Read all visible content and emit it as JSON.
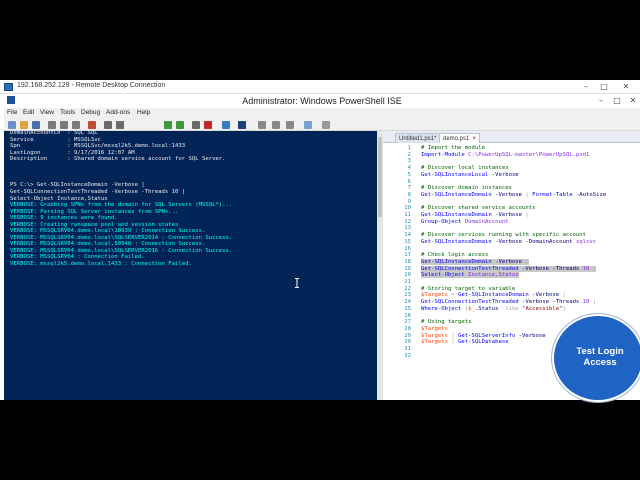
{
  "rdp": {
    "title": "192.168.252.129 - Remote Desktop Connection",
    "controls": [
      "–",
      "□",
      "✕"
    ]
  },
  "ise": {
    "title": "Administrator: Windows PowerShell ISE",
    "controls": [
      "–",
      "□",
      "✕"
    ],
    "menu": [
      "File",
      "Edit",
      "View",
      "Tools",
      "Debug",
      "Add-ons",
      "Help"
    ]
  },
  "console": {
    "lines": [
      {
        "text": "DomainAccountCn  : SQL SQL",
        "kind": "normal"
      },
      {
        "text": "Service          : MSSQLSvc",
        "kind": "normal"
      },
      {
        "text": "Spn              : MSSQLSvc/mssql2k5.demo.local:1433",
        "kind": "normal"
      },
      {
        "text": "LastLogon        : 9/17/2016 12:07 AM",
        "kind": "normal"
      },
      {
        "text": "Description      : Shared domain service account for SQL Server.",
        "kind": "normal"
      },
      {
        "text": "",
        "kind": "normal"
      },
      {
        "text": "",
        "kind": "normal"
      },
      {
        "text": "",
        "kind": "normal"
      },
      {
        "text": "PS C:\\> Get-SQLInstanceDomain -Verbose |",
        "kind": "normal"
      },
      {
        "text": "Get-SQLConnectionTestThreaded -Verbose -Threads 10 |",
        "kind": "normal"
      },
      {
        "text": "Select-Object Instance,Status",
        "kind": "normal"
      },
      {
        "text": "VERBOSE: Grabbing SPNs from the domain for SQL Servers (MSSQL*)...",
        "kind": "verbose"
      },
      {
        "text": "VERBOSE: Parsing SQL Server instances from SPNs...",
        "kind": "verbose"
      },
      {
        "text": "VERBOSE: 9 instances were found.",
        "kind": "verbose"
      },
      {
        "text": "VERBOSE: Creating runspace pool and session states",
        "kind": "verbose"
      },
      {
        "text": "VERBOSE: MSSQLSRV04.demo.local\\10939 : Connection Success.",
        "kind": "verbose"
      },
      {
        "text": "VERBOSE: MSSQLSRV04.demo.local\\SQLSERVER2014 : Connection Success.",
        "kind": "verbose"
      },
      {
        "text": "VERBOSE: MSSQLSRV04.demo.local,50948 : Connection Success.",
        "kind": "verbose"
      },
      {
        "text": "VERBOSE: MSSQLSRV04.demo.local\\SQLSERVER2016 : Connection Success.",
        "kind": "verbose"
      },
      {
        "text": "VERBOSE: MSSQLSRV04 : Connection Failed.",
        "kind": "verbose"
      },
      {
        "text": "VERBOSE: mssql2k5.demo.local,1433 : Connection Failed.",
        "kind": "verbose"
      }
    ]
  },
  "editor": {
    "tabs": [
      {
        "label": "Untitled1.ps1*",
        "active": false
      },
      {
        "label": "demo.ps1",
        "active": true
      }
    ],
    "lines": [
      {
        "num": "1",
        "parts": [
          {
            "t": "# Import the module",
            "c": "c-comment"
          }
        ]
      },
      {
        "num": "2",
        "parts": [
          {
            "t": "Import-Module ",
            "c": "c-cmd"
          },
          {
            "t": "C:\\PowerUpSQL-master\\PowerUpSQL.psd1",
            "c": "c-arg"
          }
        ]
      },
      {
        "num": "3",
        "parts": []
      },
      {
        "num": "4",
        "parts": [
          {
            "t": "# Discover local instances",
            "c": "c-comment"
          }
        ]
      },
      {
        "num": "5",
        "parts": [
          {
            "t": "Get-SQLInstanceLocal ",
            "c": "c-cmd"
          },
          {
            "t": "-Verbose",
            "c": "c-param"
          }
        ]
      },
      {
        "num": "6",
        "parts": []
      },
      {
        "num": "7",
        "parts": [
          {
            "t": "# Discover domain instances",
            "c": "c-comment"
          }
        ]
      },
      {
        "num": "8",
        "parts": [
          {
            "t": "Get-SQLInstanceDomain ",
            "c": "c-cmd"
          },
          {
            "t": "-Verbose ",
            "c": "c-param"
          },
          {
            "t": "| ",
            "c": "c-op"
          },
          {
            "t": "Format-Table ",
            "c": "c-cmd"
          },
          {
            "t": "-AutoSize",
            "c": "c-param"
          }
        ]
      },
      {
        "num": "9",
        "parts": []
      },
      {
        "num": "10",
        "parts": [
          {
            "t": "# Discover shared service accounts",
            "c": "c-comment"
          }
        ]
      },
      {
        "num": "11",
        "parts": [
          {
            "t": "Get-SQLInstanceDomain ",
            "c": "c-cmd"
          },
          {
            "t": "-Verbose ",
            "c": "c-param"
          },
          {
            "t": "|",
            "c": "c-op"
          }
        ]
      },
      {
        "num": "12",
        "parts": [
          {
            "t": "Group-Object ",
            "c": "c-cmd"
          },
          {
            "t": "DomainAccount",
            "c": "c-arg"
          }
        ]
      },
      {
        "num": "13",
        "parts": []
      },
      {
        "num": "14",
        "parts": [
          {
            "t": "# Discover services running with specific account",
            "c": "c-comment"
          }
        ]
      },
      {
        "num": "15",
        "parts": [
          {
            "t": "Get-SQLInstanceDomain ",
            "c": "c-cmd"
          },
          {
            "t": "-Verbose ",
            "c": "c-param"
          },
          {
            "t": "-DomainAccount ",
            "c": "c-param"
          },
          {
            "t": "sqlsvc",
            "c": "c-arg"
          }
        ]
      },
      {
        "num": "16",
        "parts": []
      },
      {
        "num": "17",
        "parts": [
          {
            "t": "# Check login access",
            "c": "c-comment"
          }
        ]
      },
      {
        "num": "18",
        "hl": true,
        "parts": [
          {
            "t": "Get-SQLInstanceDomain ",
            "c": "c-cmd"
          },
          {
            "t": "-Verbose ",
            "c": "c-param"
          },
          {
            "t": "|",
            "c": "c-op"
          }
        ]
      },
      {
        "num": "19",
        "hl": true,
        "parts": [
          {
            "t": "Get-SQLConnectionTestThreaded ",
            "c": "c-cmd"
          },
          {
            "t": "-Verbose ",
            "c": "c-param"
          },
          {
            "t": "-Threads ",
            "c": "c-param"
          },
          {
            "t": "10 ",
            "c": "c-arg"
          },
          {
            "t": "|",
            "c": "c-op"
          }
        ]
      },
      {
        "num": "20",
        "hl": true,
        "parts": [
          {
            "t": "Select-Object ",
            "c": "c-cmd"
          },
          {
            "t": "Instance,Status",
            "c": "c-arg"
          }
        ]
      },
      {
        "num": "21",
        "parts": []
      },
      {
        "num": "22",
        "parts": [
          {
            "t": "# Storing target to variable",
            "c": "c-comment"
          }
        ]
      },
      {
        "num": "23",
        "parts": [
          {
            "t": "$Targets ",
            "c": "c-var"
          },
          {
            "t": "= ",
            "c": "c-op"
          },
          {
            "t": "Get-SQLInstanceDomain ",
            "c": "c-cmd"
          },
          {
            "t": "-Verbose ",
            "c": "c-param"
          },
          {
            "t": "|",
            "c": "c-op"
          }
        ]
      },
      {
        "num": "24",
        "parts": [
          {
            "t": "Get-SQLConnectionTestThreaded ",
            "c": "c-cmd"
          },
          {
            "t": "-Verbose ",
            "c": "c-param"
          },
          {
            "t": "-Threads ",
            "c": "c-param"
          },
          {
            "t": "10 ",
            "c": "c-arg"
          },
          {
            "t": "|",
            "c": "c-op"
          }
        ]
      },
      {
        "num": "25",
        "parts": [
          {
            "t": "Where-Object ",
            "c": "c-cmd"
          },
          {
            "t": "{",
            "c": "c-op"
          },
          {
            "t": "$_",
            "c": "c-var"
          },
          {
            "t": ".Status ",
            "c": "c-param"
          },
          {
            "t": "-like ",
            "c": "c-op"
          },
          {
            "t": "\"Accessible\"",
            "c": "c-str"
          },
          {
            "t": "}",
            "c": "c-op"
          }
        ]
      },
      {
        "num": "26",
        "parts": []
      },
      {
        "num": "27",
        "parts": [
          {
            "t": "# Using targets",
            "c": "c-comment"
          }
        ]
      },
      {
        "num": "28",
        "parts": [
          {
            "t": "$Targets",
            "c": "c-var"
          }
        ]
      },
      {
        "num": "29",
        "parts": [
          {
            "t": "$Targets ",
            "c": "c-var"
          },
          {
            "t": "| ",
            "c": "c-op"
          },
          {
            "t": "Get-SQLServerInfo ",
            "c": "c-cmd"
          },
          {
            "t": "-Verbose",
            "c": "c-param"
          }
        ]
      },
      {
        "num": "30",
        "parts": [
          {
            "t": "$Targets ",
            "c": "c-var"
          },
          {
            "t": "| ",
            "c": "c-op"
          },
          {
            "t": "Get-SQLDatabase",
            "c": "c-cmd"
          }
        ]
      },
      {
        "num": "31",
        "parts": []
      },
      {
        "num": "32",
        "parts": []
      }
    ]
  },
  "badge": {
    "label": "Test Login Access",
    "color": "#1f63c4"
  },
  "colors": {
    "console_bg": "#012456",
    "console_text": "#eeedf0",
    "verbose_text": "#00ffff",
    "selection": "#c9c9c9"
  },
  "icons": {
    "toolbar": [
      "new-file-icon",
      "open-icon",
      "save-icon",
      "cut-icon",
      "copy-icon",
      "paste-icon",
      "clear-icon",
      "undo-icon",
      "redo-icon",
      "run-icon",
      "run-selection-icon",
      "debug-icon",
      "stop-icon",
      "remote-icon",
      "console-icon",
      "layout-top-icon",
      "layout-side-icon",
      "layout-max-icon",
      "show-commands-icon",
      "addon-icon"
    ],
    "cursor": "text-cursor-icon"
  }
}
